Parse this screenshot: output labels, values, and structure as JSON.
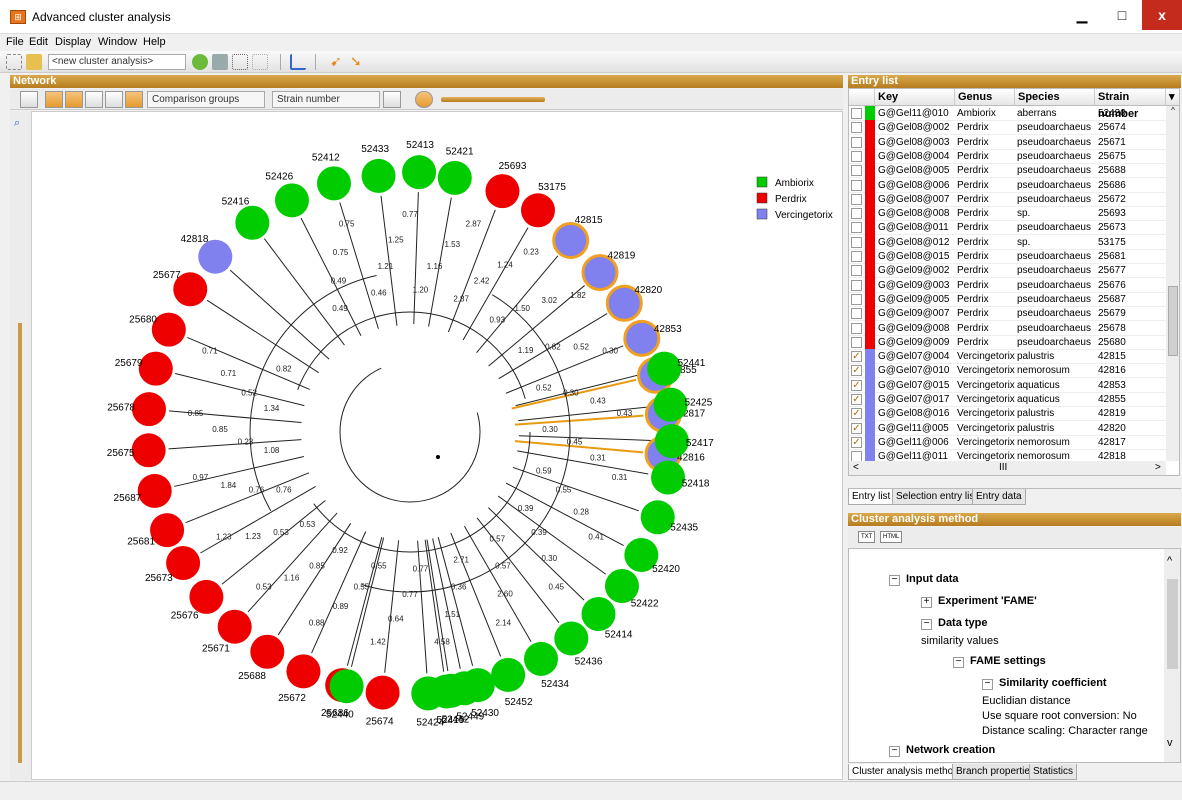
{
  "window": {
    "title": "Advanced cluster analysis",
    "min": "▁",
    "max": "□",
    "close": "x"
  },
  "menu": [
    "File",
    "Edit",
    "Display",
    "Window",
    "Help"
  ],
  "toolbar": {
    "cluster_placeholder": "<new cluster analysis>"
  },
  "network": {
    "panel_title": "Network",
    "comparison_groups": "Comparison groups",
    "strain_number": "Strain number",
    "legend": [
      {
        "label": "Ambiorix",
        "color": "#00cc00"
      },
      {
        "label": "Perdrix",
        "color": "#ee0000"
      },
      {
        "label": "Vercingetorix",
        "color": "#8080ee"
      }
    ],
    "nodes": [
      {
        "label": "52412",
        "genus": "Ambiorix"
      },
      {
        "label": "52433",
        "genus": "Ambiorix"
      },
      {
        "label": "52413",
        "genus": "Ambiorix"
      },
      {
        "label": "52421",
        "genus": "Ambiorix"
      },
      {
        "label": "52426",
        "genus": "Ambiorix"
      },
      {
        "label": "52416",
        "genus": "Ambiorix"
      },
      {
        "label": "25693",
        "genus": "Perdrix"
      },
      {
        "label": "53175",
        "genus": "Perdrix"
      },
      {
        "label": "42815",
        "genus": "Vercingetorix"
      },
      {
        "label": "42819",
        "genus": "Vercingetorix"
      },
      {
        "label": "42820",
        "genus": "Vercingetorix"
      },
      {
        "label": "42853",
        "genus": "Vercingetorix"
      },
      {
        "label": "42855",
        "genus": "Vercingetorix"
      },
      {
        "label": "42817",
        "genus": "Vercingetorix"
      },
      {
        "label": "42816",
        "genus": "Vercingetorix"
      },
      {
        "label": "42818",
        "genus": "Vercingetorix"
      },
      {
        "label": "25677",
        "genus": "Perdrix"
      },
      {
        "label": "25680",
        "genus": "Perdrix"
      },
      {
        "label": "25679",
        "genus": "Perdrix"
      },
      {
        "label": "25678",
        "genus": "Perdrix"
      },
      {
        "label": "25675",
        "genus": "Perdrix"
      },
      {
        "label": "25687",
        "genus": "Perdrix"
      },
      {
        "label": "25681",
        "genus": "Perdrix"
      },
      {
        "label": "25673",
        "genus": "Perdrix"
      },
      {
        "label": "25676",
        "genus": "Perdrix"
      },
      {
        "label": "25671",
        "genus": "Perdrix"
      },
      {
        "label": "25688",
        "genus": "Perdrix"
      },
      {
        "label": "25672",
        "genus": "Perdrix"
      },
      {
        "label": "25686",
        "genus": "Perdrix"
      },
      {
        "label": "25674",
        "genus": "Perdrix"
      },
      {
        "label": "52440",
        "genus": "Ambiorix"
      },
      {
        "label": "52424",
        "genus": "Ambiorix"
      },
      {
        "label": "52415",
        "genus": "Ambiorix"
      },
      {
        "label": "52442",
        "genus": "Ambiorix"
      },
      {
        "label": "52449",
        "genus": "Ambiorix"
      },
      {
        "label": "52430",
        "genus": "Ambiorix"
      },
      {
        "label": "52452",
        "genus": "Ambiorix"
      },
      {
        "label": "52434",
        "genus": "Ambiorix"
      },
      {
        "label": "52436",
        "genus": "Ambiorix"
      },
      {
        "label": "52414",
        "genus": "Ambiorix"
      },
      {
        "label": "52422",
        "genus": "Ambiorix"
      },
      {
        "label": "52420",
        "genus": "Ambiorix"
      },
      {
        "label": "52435",
        "genus": "Ambiorix"
      },
      {
        "label": "52418",
        "genus": "Ambiorix"
      },
      {
        "label": "52417",
        "genus": "Ambiorix"
      },
      {
        "label": "52425",
        "genus": "Ambiorix"
      },
      {
        "label": "52441",
        "genus": "Ambiorix"
      }
    ],
    "branch_labels": [
      "0.49",
      "0.49",
      "0.75",
      "0.75",
      "0.46",
      "1.21",
      "1.25",
      "0.77",
      "1.20",
      "1.16",
      "1.53",
      "2.87",
      "2.87",
      "2.42",
      "1.24",
      "0.23",
      "0.93",
      "1.50",
      "3.02",
      "1.82",
      "1.19",
      "0.82",
      "0.52",
      "0.30",
      "0.52",
      "0.30",
      "0.43",
      "0.43",
      "0.30",
      "0.45",
      "0.31",
      "0.31",
      "0.59",
      "0.55",
      "0.28",
      "0.41",
      "0.39",
      "0.39",
      "0.30",
      "0.45",
      "0.57",
      "0.57",
      "2.60",
      "2.14",
      "2.71",
      "0.36",
      "1.51",
      "4.58",
      "0.77",
      "0.77",
      "0.64",
      "1.42",
      "0.55",
      "0.55",
      "0.89",
      "0.88",
      "0.92",
      "0.85",
      "1.16",
      "0.53",
      "0.53",
      "0.53",
      "1.23",
      "1.23",
      "0.76",
      "0.76",
      "1.84",
      "0.97",
      "1.08",
      "0.23",
      "0.85",
      "0.85",
      "1.34",
      "0.52",
      "0.71",
      "0.71",
      "0.82"
    ]
  },
  "entry_list": {
    "title": "Entry list",
    "columns": [
      "Key",
      "Genus",
      "Species",
      "Strain number"
    ],
    "rows": [
      {
        "checked": false,
        "color": "#00cc00",
        "key": "G@Gel11@010",
        "genus": "Ambiorix",
        "species": "aberrans",
        "strain": "52430"
      },
      {
        "checked": false,
        "color": "#ee0000",
        "key": "G@Gel08@002",
        "genus": "Perdrix",
        "species": "pseudoarchaeus",
        "strain": "25674"
      },
      {
        "checked": false,
        "color": "#ee0000",
        "key": "G@Gel08@003",
        "genus": "Perdrix",
        "species": "pseudoarchaeus",
        "strain": "25671"
      },
      {
        "checked": false,
        "color": "#ee0000",
        "key": "G@Gel08@004",
        "genus": "Perdrix",
        "species": "pseudoarchaeus",
        "strain": "25675"
      },
      {
        "checked": false,
        "color": "#ee0000",
        "key": "G@Gel08@005",
        "genus": "Perdrix",
        "species": "pseudoarchaeus",
        "strain": "25688"
      },
      {
        "checked": false,
        "color": "#ee0000",
        "key": "G@Gel08@006",
        "genus": "Perdrix",
        "species": "pseudoarchaeus",
        "strain": "25686"
      },
      {
        "checked": false,
        "color": "#ee0000",
        "key": "G@Gel08@007",
        "genus": "Perdrix",
        "species": "pseudoarchaeus",
        "strain": "25672"
      },
      {
        "checked": false,
        "color": "#ee0000",
        "key": "G@Gel08@008",
        "genus": "Perdrix",
        "species": "sp.",
        "strain": "25693"
      },
      {
        "checked": false,
        "color": "#ee0000",
        "key": "G@Gel08@011",
        "genus": "Perdrix",
        "species": "pseudoarchaeus",
        "strain": "25673"
      },
      {
        "checked": false,
        "color": "#ee0000",
        "key": "G@Gel08@012",
        "genus": "Perdrix",
        "species": "sp.",
        "strain": "53175"
      },
      {
        "checked": false,
        "color": "#ee0000",
        "key": "G@Gel08@015",
        "genus": "Perdrix",
        "species": "pseudoarchaeus",
        "strain": "25681"
      },
      {
        "checked": false,
        "color": "#ee0000",
        "key": "G@Gel09@002",
        "genus": "Perdrix",
        "species": "pseudoarchaeus",
        "strain": "25677"
      },
      {
        "checked": false,
        "color": "#ee0000",
        "key": "G@Gel09@003",
        "genus": "Perdrix",
        "species": "pseudoarchaeus",
        "strain": "25676"
      },
      {
        "checked": false,
        "color": "#ee0000",
        "key": "G@Gel09@005",
        "genus": "Perdrix",
        "species": "pseudoarchaeus",
        "strain": "25687"
      },
      {
        "checked": false,
        "color": "#ee0000",
        "key": "G@Gel09@007",
        "genus": "Perdrix",
        "species": "pseudoarchaeus",
        "strain": "25679"
      },
      {
        "checked": false,
        "color": "#ee0000",
        "key": "G@Gel09@008",
        "genus": "Perdrix",
        "species": "pseudoarchaeus",
        "strain": "25678"
      },
      {
        "checked": false,
        "color": "#ee0000",
        "key": "G@Gel09@009",
        "genus": "Perdrix",
        "species": "pseudoarchaeus",
        "strain": "25680"
      },
      {
        "checked": true,
        "color": "#8080ee",
        "key": "G@Gel07@004",
        "genus": "Vercingetorix",
        "species": "palustris",
        "strain": "42815"
      },
      {
        "checked": true,
        "color": "#8080ee",
        "key": "G@Gel07@010",
        "genus": "Vercingetorix",
        "species": "nemorosum",
        "strain": "42816"
      },
      {
        "checked": true,
        "color": "#8080ee",
        "key": "G@Gel07@015",
        "genus": "Vercingetorix",
        "species": "aquaticus",
        "strain": "42853"
      },
      {
        "checked": true,
        "color": "#8080ee",
        "key": "G@Gel07@017",
        "genus": "Vercingetorix",
        "species": "aquaticus",
        "strain": "42855"
      },
      {
        "checked": true,
        "color": "#8080ee",
        "key": "G@Gel08@016",
        "genus": "Vercingetorix",
        "species": "palustris",
        "strain": "42819"
      },
      {
        "checked": true,
        "color": "#8080ee",
        "key": "G@Gel11@005",
        "genus": "Vercingetorix",
        "species": "palustris",
        "strain": "42820"
      },
      {
        "checked": true,
        "color": "#8080ee",
        "key": "G@Gel11@006",
        "genus": "Vercingetorix",
        "species": "nemorosum",
        "strain": "42817"
      },
      {
        "checked": false,
        "color": "#8080ee",
        "key": "G@Gel11@011",
        "genus": "Vercingetorix",
        "species": "nemorosum",
        "strain": "42818"
      }
    ],
    "tabs": [
      "Entry list",
      "Selection entry list",
      "Entry data"
    ]
  },
  "method": {
    "title": "Cluster analysis method",
    "txt": "TXT",
    "html": "HTML",
    "input_data": "Input data",
    "experiment": "Experiment 'FAME'",
    "data_type": "Data type",
    "similarity_values": "similarity values",
    "fame_settings": "FAME settings",
    "similarity_coefficient": "Similarity coefficient",
    "euclidian": "Euclidian distance",
    "sqrt": "Use square root conversion: No",
    "scaling": "Distance scaling: Character range",
    "network_creation": "Network creation",
    "tabs": [
      "Cluster analysis method",
      "Branch properties",
      "Statistics"
    ]
  },
  "scrollbar": {
    "thumb": "III"
  }
}
